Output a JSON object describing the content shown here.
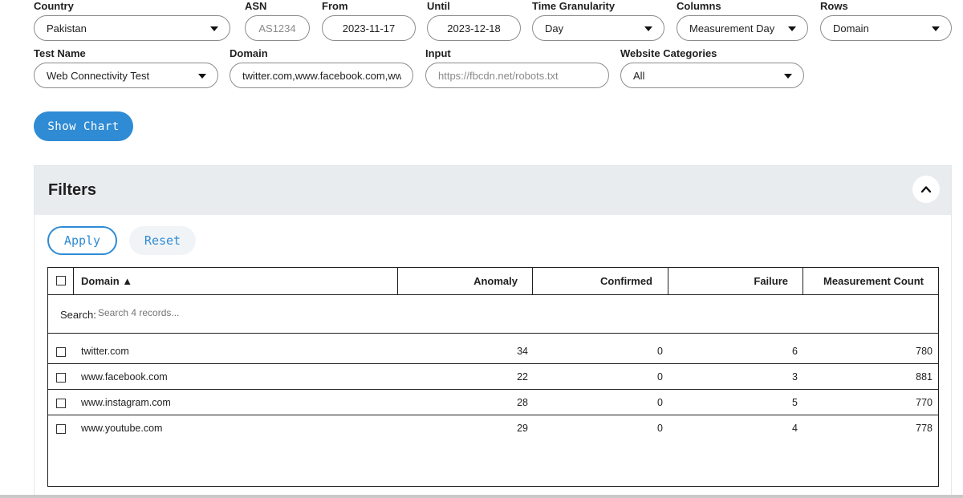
{
  "form": {
    "country": {
      "label": "Country",
      "value": "Pakistan"
    },
    "asn": {
      "label": "ASN",
      "placeholder": "AS1234"
    },
    "from": {
      "label": "From",
      "value": "2023-11-17"
    },
    "until": {
      "label": "Until",
      "value": "2023-12-18"
    },
    "time_granularity": {
      "label": "Time Granularity",
      "value": "Day"
    },
    "columns": {
      "label": "Columns",
      "value": "Measurement Day"
    },
    "rows": {
      "label": "Rows",
      "value": "Domain"
    },
    "test_name": {
      "label": "Test Name",
      "value": "Web Connectivity Test"
    },
    "domain": {
      "label": "Domain",
      "value": "twitter.com,www.facebook.com,ww"
    },
    "input": {
      "label": "Input",
      "placeholder": "https://fbcdn.net/robots.txt"
    },
    "website_categories": {
      "label": "Website Categories",
      "value": "All"
    },
    "show_chart_label": "Show Chart"
  },
  "filters": {
    "title": "Filters",
    "apply_label": "Apply",
    "reset_label": "Reset"
  },
  "table": {
    "headers": {
      "domain": "Domain ▲",
      "anomaly": "Anomaly",
      "confirmed": "Confirmed",
      "failure": "Failure",
      "measurement_count": "Measurement Count"
    },
    "search_label": "Search:",
    "search_placeholder": "Search 4 records...",
    "rows": [
      {
        "domain": "twitter.com",
        "anomaly": "34",
        "confirmed": "0",
        "failure": "6",
        "count": "780"
      },
      {
        "domain": "www.facebook.com",
        "anomaly": "22",
        "confirmed": "0",
        "failure": "3",
        "count": "881"
      },
      {
        "domain": "www.instagram.com",
        "anomaly": "28",
        "confirmed": "0",
        "failure": "5",
        "count": "770"
      },
      {
        "domain": "www.youtube.com",
        "anomaly": "29",
        "confirmed": "0",
        "failure": "4",
        "count": "778"
      }
    ]
  },
  "colors": {
    "accent": "#2f8bd4",
    "panel_header": "#e8ecef"
  },
  "icons": {
    "dropdown": "caret-down-icon",
    "collapse": "chevron-up-icon"
  }
}
